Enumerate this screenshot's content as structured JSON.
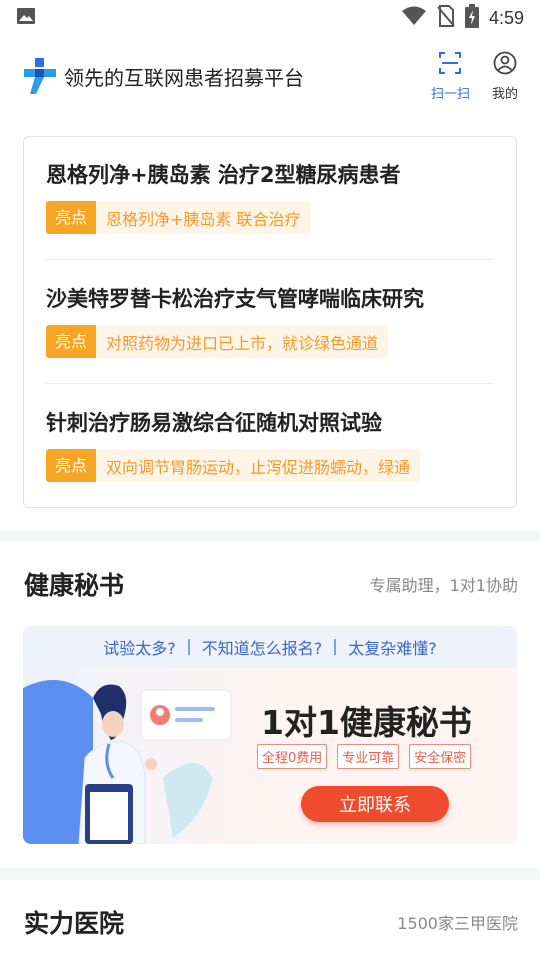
{
  "status_bar": {
    "time": "4:59",
    "icons": [
      "image-icon",
      "wifi-icon",
      "no-sim-icon",
      "battery-charging-icon"
    ]
  },
  "header": {
    "title": "领先的互联网患者招募平台",
    "scan_label": "扫一扫",
    "mine_label": "我的"
  },
  "trials": [
    {
      "title": "恩格列净+胰岛素 治疗2型糖尿病患者",
      "tag": "亮点",
      "highlight": "恩格列净+胰岛素 联合治疗"
    },
    {
      "title": "沙美特罗替卡松治疗支气管哮喘临床研究",
      "tag": "亮点",
      "highlight": "对照药物为进口已上市，就诊绿色通道"
    },
    {
      "title": "针刺治疗肠易激综合征随机对照试验",
      "tag": "亮点",
      "highlight": "双向调节胃肠运动，止泻促进肠蠕动，绿通"
    }
  ],
  "health_secretary": {
    "title": "健康秘书",
    "subtitle": "专属助理，1对1协助",
    "banner": {
      "questions": [
        "试验太多?",
        "不知道怎么报名?",
        "太复杂难懂?"
      ],
      "headline": "1对1健康秘书",
      "tags": [
        "全程0费用",
        "专业可靠",
        "安全保密"
      ],
      "button": "立即联系"
    }
  },
  "hospitals": {
    "title": "实力医院",
    "subtitle": "1500家三甲医院"
  },
  "colors": {
    "accent_blue": "#2f6fe4",
    "highlight_orange": "#f7a524",
    "cta_red": "#f04b2c"
  }
}
